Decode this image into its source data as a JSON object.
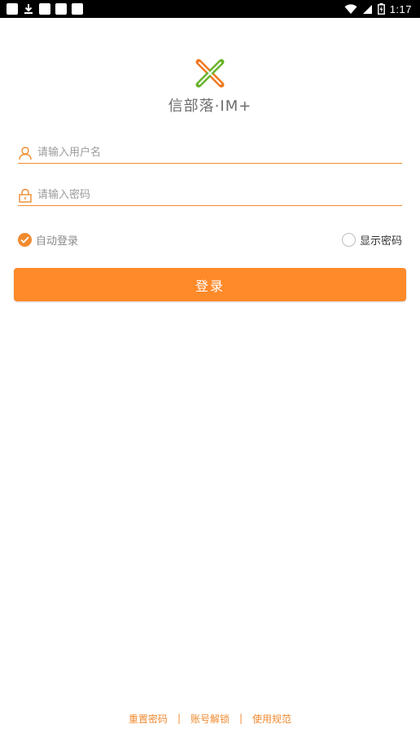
{
  "status_bar": {
    "time": "1:17",
    "left_icons": [
      "notification-square-icon",
      "download-icon",
      "notification-square-icon",
      "notification-square-icon",
      "notification-square-icon"
    ],
    "right_icons": [
      "wifi-icon",
      "signal-icon",
      "battery-icon"
    ]
  },
  "app": {
    "logo_text": "信部落·IM+",
    "colors": {
      "accent": "#ff8a2a",
      "logo_green": "#6ab42d",
      "logo_orange": "#f07a22"
    }
  },
  "form": {
    "username": {
      "placeholder": "请输入用户名",
      "value": ""
    },
    "password": {
      "placeholder": "请输入密码",
      "value": ""
    },
    "auto_login": {
      "label": "自动登录",
      "checked": true
    },
    "show_password": {
      "label": "显示密码",
      "checked": false
    },
    "login_label": "登录"
  },
  "footer": {
    "reset_password": "重置密码",
    "separator": "|",
    "unlock_account": "账号解锁",
    "usage_rules": "使用规范"
  }
}
